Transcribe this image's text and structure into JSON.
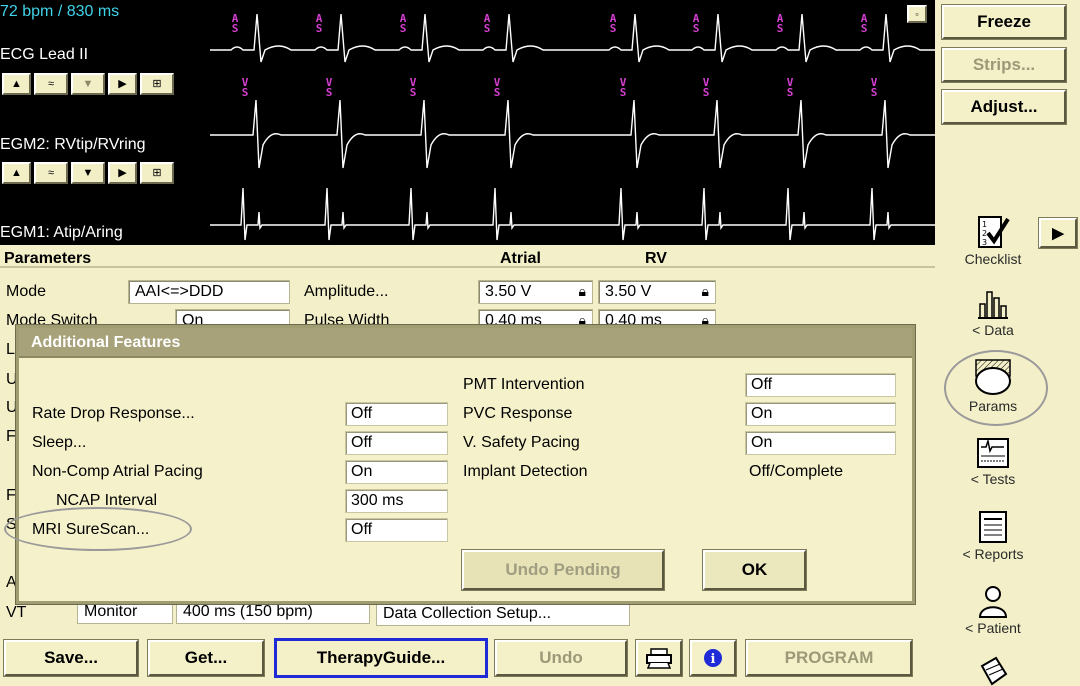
{
  "ecg": {
    "heart_rate": "72 bpm / 830 ms",
    "channels": [
      "ECG Lead II",
      "EGM2: RVtip/RVring",
      "EGM1: Atip/Aring"
    ],
    "marker_atrial": "AS",
    "marker_ventricular": "VS"
  },
  "right_panel": {
    "freeze": "Freeze",
    "strips": "Strips...",
    "adjust": "Adjust...",
    "nav": {
      "checklist": "Checklist",
      "data": "< Data",
      "params": "Params",
      "tests": "< Tests",
      "reports": "< Reports",
      "patient": "< Patient"
    }
  },
  "params": {
    "header": "Parameters",
    "col_atrial": "Atrial",
    "col_rv": "RV",
    "mode_label": "Mode",
    "mode_value": "AAI<=>DDD",
    "amplitude_label": "Amplitude...",
    "amp_atrial": "3.50 V",
    "amp_rv": "3.50 V",
    "mode_switch_label": "Mode Switch",
    "mode_switch_value": "On",
    "pulse_width_label": "Pulse Width",
    "pw_atrial": "0.40 ms",
    "pw_rv": "0.40 ms",
    "partial_left": [
      "L",
      "U",
      "U",
      "F",
      "F",
      "S",
      "A"
    ],
    "vt_label": "VT",
    "vt_value": "Monitor",
    "vt_interval": "400 ms (150 bpm)",
    "data_collection": "Data Collection Setup..."
  },
  "dialog": {
    "title": "Additional Features",
    "left": [
      {
        "label": "Rate Drop Response...",
        "value": "Off"
      },
      {
        "label": "Sleep...",
        "value": "Off"
      },
      {
        "label": "Non-Comp Atrial Pacing",
        "value": "On"
      },
      {
        "label": "NCAP Interval",
        "value": "300 ms"
      },
      {
        "label": "MRI SureScan...",
        "value": "Off"
      }
    ],
    "right": [
      {
        "label": "PMT Intervention",
        "value": "Off"
      },
      {
        "label": "PVC Response",
        "value": "On"
      },
      {
        "label": "V. Safety Pacing",
        "value": "On"
      },
      {
        "label": "Implant Detection",
        "value": "Off/Complete"
      }
    ],
    "undo_pending": "Undo Pending",
    "ok": "OK"
  },
  "bottom": {
    "save": "Save...",
    "get": "Get...",
    "therapy_guide": "TherapyGuide...",
    "undo": "Undo",
    "program": "PROGRAM"
  },
  "colors": {
    "background": "#f3f0c9",
    "heart_rate_text": "#3fd3e8",
    "marker": "#d43fd0",
    "focus_border": "#1f2bd6",
    "dialog_title": "#a7a27a"
  }
}
